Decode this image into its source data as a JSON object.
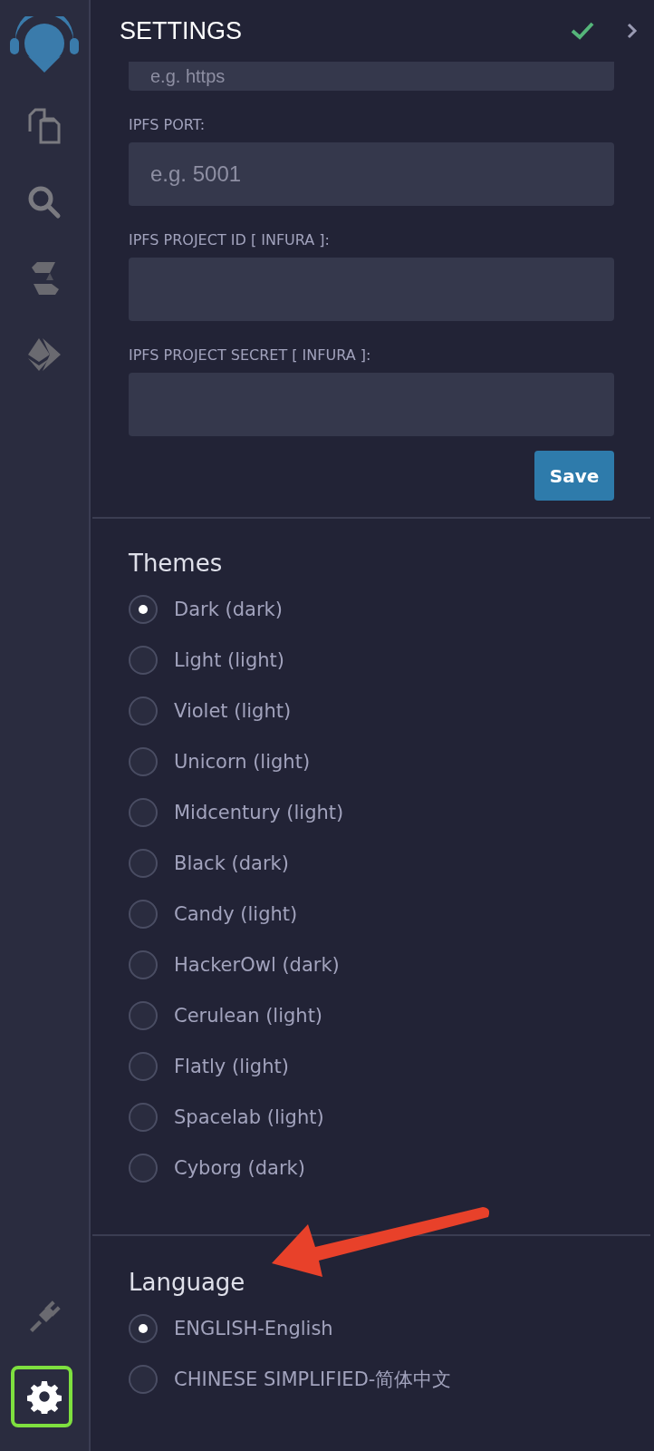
{
  "header": {
    "title": "SETTINGS"
  },
  "fields": [
    {
      "placeholder": "e.g. https"
    },
    {
      "label": "IPFS PORT:",
      "placeholder": "e.g. 5001"
    },
    {
      "label": "IPFS PROJECT ID [ INFURA ]:"
    },
    {
      "label": "IPFS PROJECT SECRET [ INFURA ]:"
    }
  ],
  "save_button": "Save",
  "themes": {
    "title": "Themes",
    "options": [
      {
        "label": "Dark (dark)",
        "selected": true
      },
      {
        "label": "Light (light)",
        "selected": false
      },
      {
        "label": "Violet (light)",
        "selected": false
      },
      {
        "label": "Unicorn (light)",
        "selected": false
      },
      {
        "label": "Midcentury (light)",
        "selected": false
      },
      {
        "label": "Black (dark)",
        "selected": false
      },
      {
        "label": "Candy (light)",
        "selected": false
      },
      {
        "label": "HackerOwl (dark)",
        "selected": false
      },
      {
        "label": "Cerulean (light)",
        "selected": false
      },
      {
        "label": "Flatly (light)",
        "selected": false
      },
      {
        "label": "Spacelab (light)",
        "selected": false
      },
      {
        "label": "Cyborg (dark)",
        "selected": false
      }
    ]
  },
  "language": {
    "title": "Language",
    "options": [
      {
        "label": "ENGLISH-English",
        "selected": true
      },
      {
        "label": "CHINESE SIMPLIFIED-简体中文",
        "selected": false
      }
    ]
  }
}
